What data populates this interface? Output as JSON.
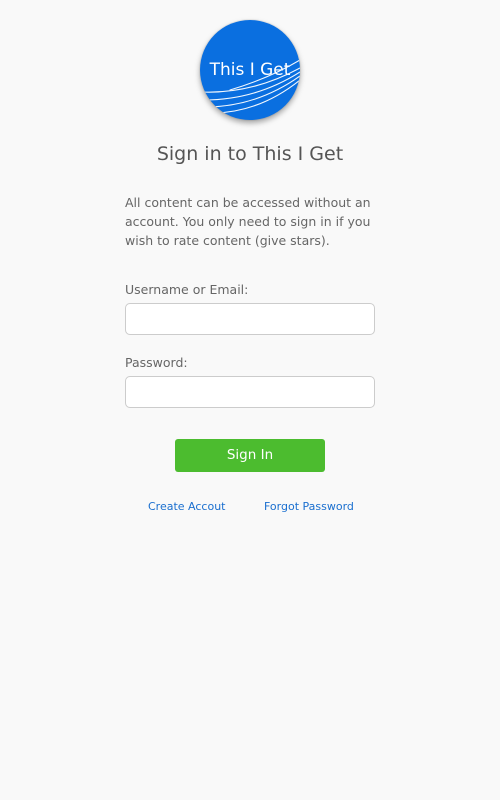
{
  "logo": {
    "text": "This I Get",
    "icon": "swoosh-lines-icon",
    "color": "#0a6fe0"
  },
  "page": {
    "title": "Sign in to This I Get",
    "intro": "All content can be accessed without an account. You only need to sign in if you wish to rate content (give stars)."
  },
  "form": {
    "username_label": "Username or Email:",
    "username_value": "",
    "password_label": "Password:",
    "password_value": "",
    "signin_label": "Sign In",
    "signin_color": "#4cbc2f"
  },
  "links": {
    "create_account": "Create Accout",
    "forgot_password": "Forgot Password",
    "color": "#1a6fcf"
  }
}
